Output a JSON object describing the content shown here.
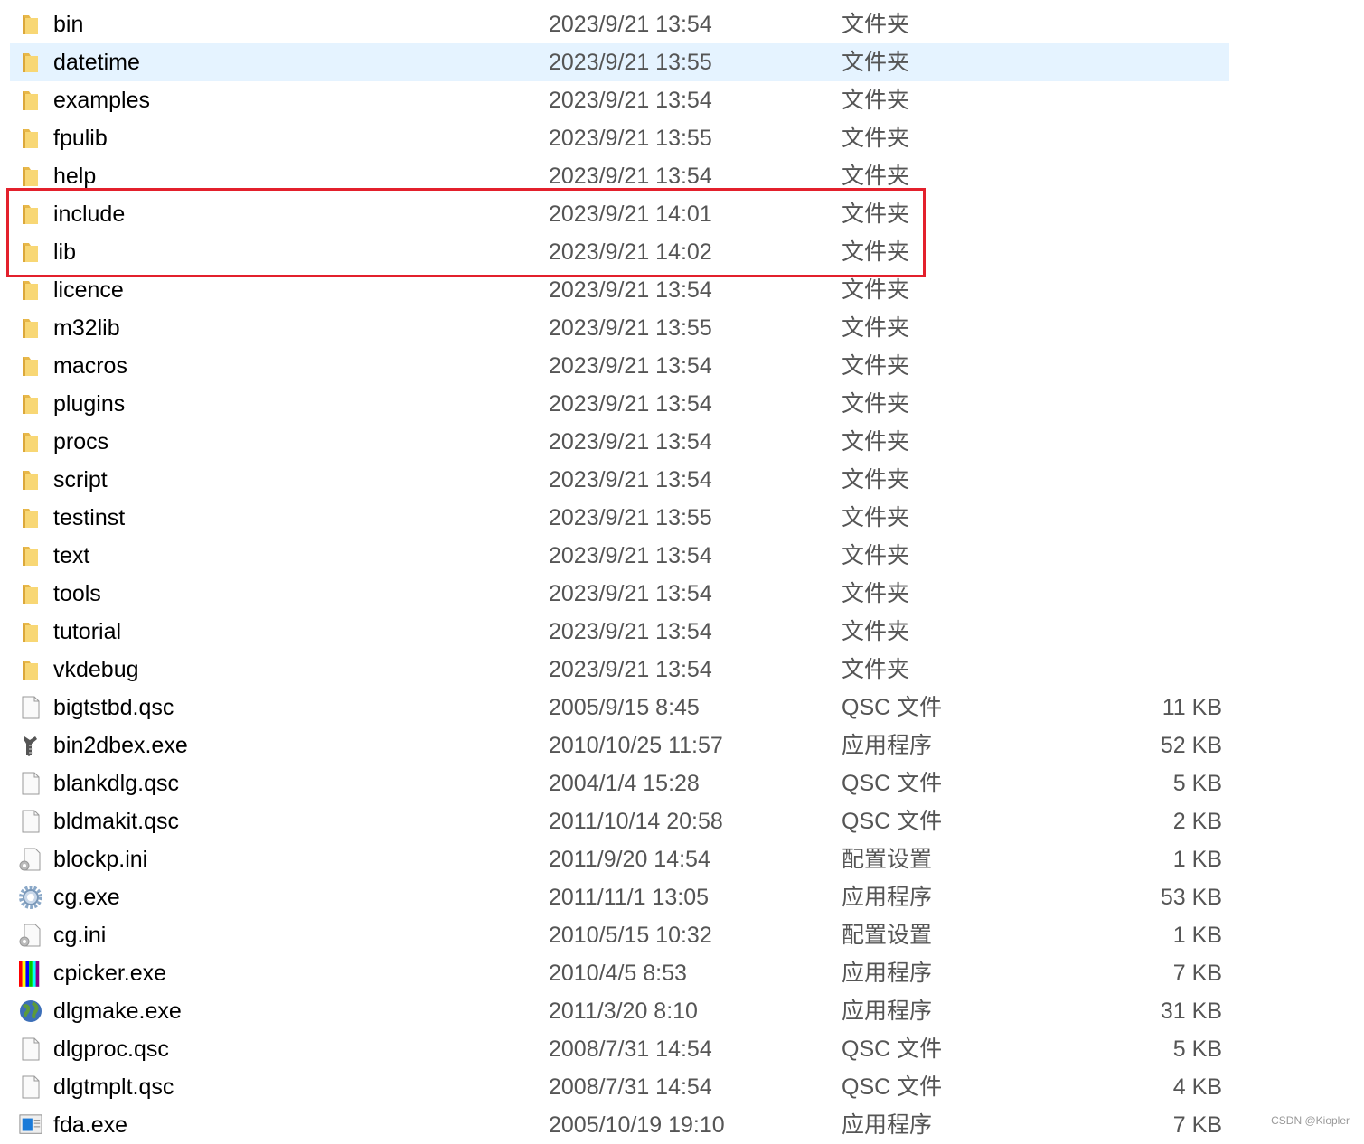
{
  "hovered_index": 1,
  "highlight_color": "#e3202c",
  "hover_color": "#e5f3ff",
  "files": [
    {
      "name": "bin",
      "date": "2023/9/21 13:54",
      "type": "文件夹",
      "size": "",
      "icon": "folder-icon"
    },
    {
      "name": "datetime",
      "date": "2023/9/21 13:55",
      "type": "文件夹",
      "size": "",
      "icon": "folder-icon"
    },
    {
      "name": "examples",
      "date": "2023/9/21 13:54",
      "type": "文件夹",
      "size": "",
      "icon": "folder-icon"
    },
    {
      "name": "fpulib",
      "date": "2023/9/21 13:55",
      "type": "文件夹",
      "size": "",
      "icon": "folder-icon"
    },
    {
      "name": "help",
      "date": "2023/9/21 13:54",
      "type": "文件夹",
      "size": "",
      "icon": "folder-icon"
    },
    {
      "name": "include",
      "date": "2023/9/21 14:01",
      "type": "文件夹",
      "size": "",
      "icon": "folder-icon"
    },
    {
      "name": "lib",
      "date": "2023/9/21 14:02",
      "type": "文件夹",
      "size": "",
      "icon": "folder-icon"
    },
    {
      "name": "licence",
      "date": "2023/9/21 13:54",
      "type": "文件夹",
      "size": "",
      "icon": "folder-icon"
    },
    {
      "name": "m32lib",
      "date": "2023/9/21 13:55",
      "type": "文件夹",
      "size": "",
      "icon": "folder-icon"
    },
    {
      "name": "macros",
      "date": "2023/9/21 13:54",
      "type": "文件夹",
      "size": "",
      "icon": "folder-icon"
    },
    {
      "name": "plugins",
      "date": "2023/9/21 13:54",
      "type": "文件夹",
      "size": "",
      "icon": "folder-icon"
    },
    {
      "name": "procs",
      "date": "2023/9/21 13:54",
      "type": "文件夹",
      "size": "",
      "icon": "folder-icon"
    },
    {
      "name": "script",
      "date": "2023/9/21 13:54",
      "type": "文件夹",
      "size": "",
      "icon": "folder-icon"
    },
    {
      "name": "testinst",
      "date": "2023/9/21 13:55",
      "type": "文件夹",
      "size": "",
      "icon": "folder-icon"
    },
    {
      "name": "text",
      "date": "2023/9/21 13:54",
      "type": "文件夹",
      "size": "",
      "icon": "folder-icon"
    },
    {
      "name": "tools",
      "date": "2023/9/21 13:54",
      "type": "文件夹",
      "size": "",
      "icon": "folder-icon"
    },
    {
      "name": "tutorial",
      "date": "2023/9/21 13:54",
      "type": "文件夹",
      "size": "",
      "icon": "folder-icon"
    },
    {
      "name": "vkdebug",
      "date": "2023/9/21 13:54",
      "type": "文件夹",
      "size": "",
      "icon": "folder-icon"
    },
    {
      "name": "bigtstbd.qsc",
      "date": "2005/9/15 8:45",
      "type": "QSC 文件",
      "size": "11 KB",
      "icon": "file-icon"
    },
    {
      "name": "bin2dbex.exe",
      "date": "2010/10/25 11:57",
      "type": "应用程序",
      "size": "52 KB",
      "icon": "tool-app-icon"
    },
    {
      "name": "blankdlg.qsc",
      "date": "2004/1/4 15:28",
      "type": "QSC 文件",
      "size": "5 KB",
      "icon": "file-icon"
    },
    {
      "name": "bldmakit.qsc",
      "date": "2011/10/14 20:58",
      "type": "QSC 文件",
      "size": "2 KB",
      "icon": "file-icon"
    },
    {
      "name": "blockp.ini",
      "date": "2011/9/20 14:54",
      "type": "配置设置",
      "size": "1 KB",
      "icon": "settings-file-icon"
    },
    {
      "name": "cg.exe",
      "date": "2011/11/1 13:05",
      "type": "应用程序",
      "size": "53 KB",
      "icon": "gear-app-icon"
    },
    {
      "name": "cg.ini",
      "date": "2010/5/15 10:32",
      "type": "配置设置",
      "size": "1 KB",
      "icon": "settings-file-icon"
    },
    {
      "name": "cpicker.exe",
      "date": "2010/4/5 8:53",
      "type": "应用程序",
      "size": "7 KB",
      "icon": "color-bars-icon"
    },
    {
      "name": "dlgmake.exe",
      "date": "2011/3/20 8:10",
      "type": "应用程序",
      "size": "31 KB",
      "icon": "globe-icon"
    },
    {
      "name": "dlgproc.qsc",
      "date": "2008/7/31 14:54",
      "type": "QSC 文件",
      "size": "5 KB",
      "icon": "file-icon"
    },
    {
      "name": "dlgtmplt.qsc",
      "date": "2008/7/31 14:54",
      "type": "QSC 文件",
      "size": "4 KB",
      "icon": "file-icon"
    },
    {
      "name": "fda.exe",
      "date": "2005/10/19 19:10",
      "type": "应用程序",
      "size": "7 KB",
      "icon": "window-app-icon"
    }
  ],
  "watermark": "CSDN @Kiopler"
}
